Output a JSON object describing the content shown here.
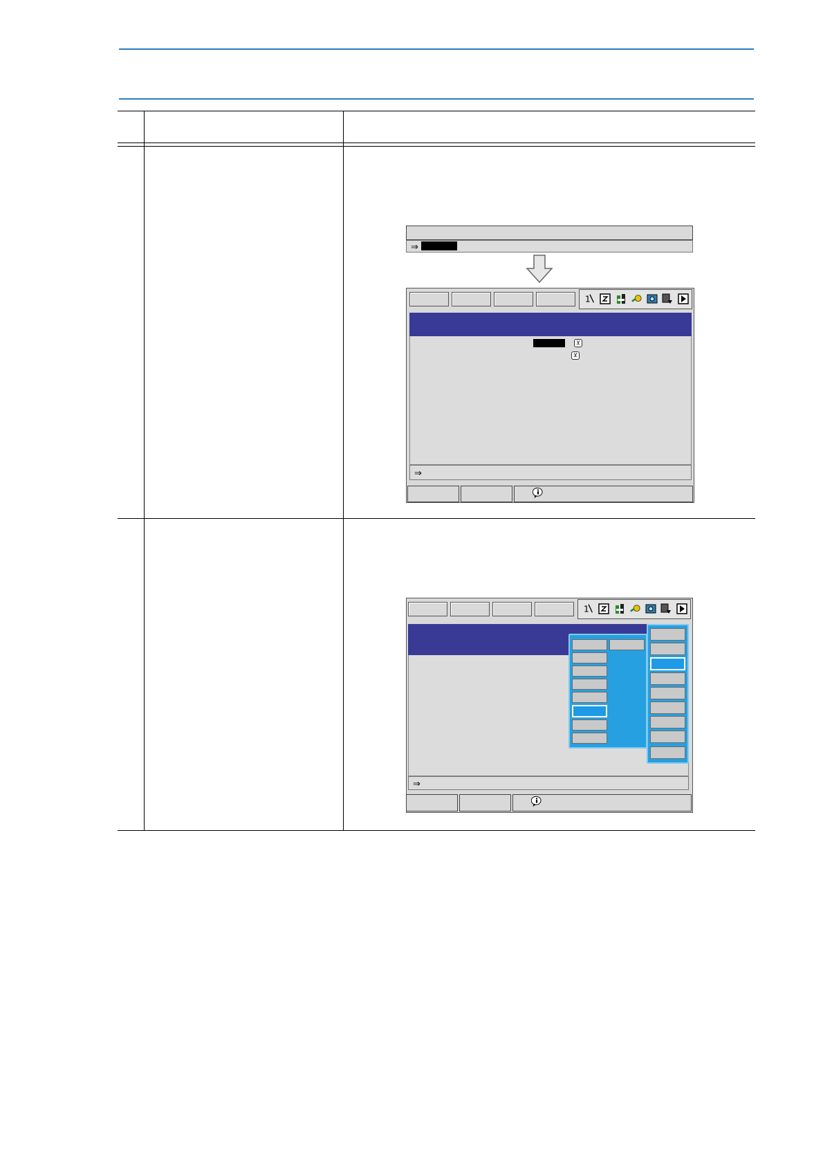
{
  "page": {
    "colors": {
      "rule_blue": "#2b7bc4",
      "title_bar": "#383a96",
      "menu_blue": "#26a0e0",
      "screen_gray": "#d9d9d9"
    }
  },
  "steps": [
    {
      "number": "",
      "operation": "",
      "explanation": ""
    },
    {
      "number": "",
      "operation": "",
      "explanation": ""
    }
  ],
  "screen1": {
    "input_prompt_symbol": "⇒",
    "status_prompt_symbol": "⇒",
    "status_icons": [
      "robot-number-icon",
      "cycle-icon",
      "teach-icon",
      "key-icon",
      "camera-icon",
      "servo-icon",
      "play-icon"
    ],
    "dropdown_symbol": "⊻"
  },
  "screen2": {
    "status_prompt_symbol": "⇒",
    "status_icons": [
      "robot-number-icon",
      "cycle-icon",
      "teach-icon",
      "key-icon",
      "camera-icon",
      "servo-icon",
      "play-icon"
    ]
  }
}
